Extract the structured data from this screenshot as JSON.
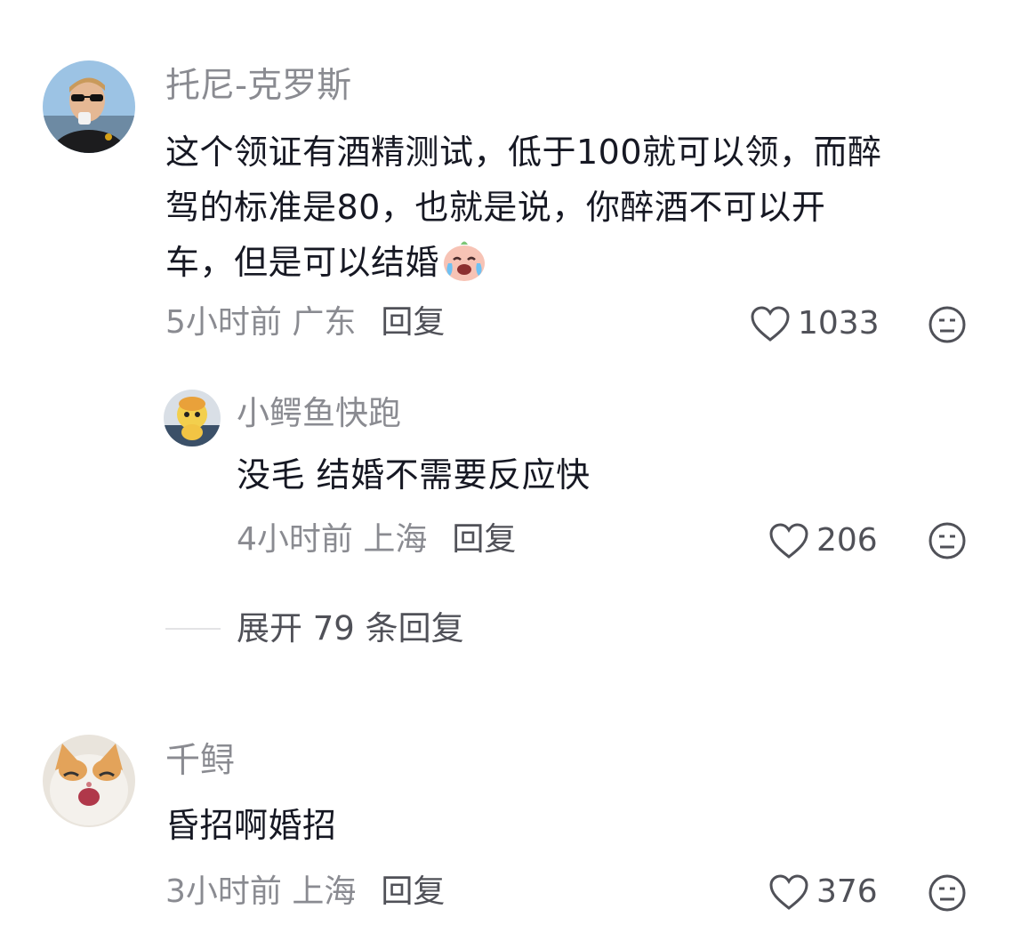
{
  "comments": [
    {
      "username": "托尼-克罗斯",
      "text_line1": "这个领证有酒精测试，低于100就可以领，而醉",
      "text_line2": "驾的标准是80，也就是说，你醉酒不可以开",
      "text_line3": "车，但是可以结婚",
      "inline_emoji": "crying-laughing-emoji",
      "time_location": "5小时前 广东",
      "reply_label": "回复",
      "likes": "1033"
    },
    {
      "username": "小鳄鱼快跑",
      "text": "没毛 结婚不需要反应快",
      "time_location": "4小时前 上海",
      "reply_label": "回复",
      "likes": "206"
    },
    {
      "username": "千鲟",
      "text": "昏招啊婚招",
      "time_location": "3小时前 上海",
      "reply_label": "回复",
      "likes": "376"
    }
  ],
  "expand_replies": "展开 79 条回复",
  "icons": {
    "like": "heart-outline-icon",
    "dislike": "meh-face-icon"
  },
  "colors": {
    "username": "#8a8b91",
    "text": "#161823",
    "meta": "#8a8b91",
    "reply": "#505158",
    "divider": "#e3e3e5"
  }
}
